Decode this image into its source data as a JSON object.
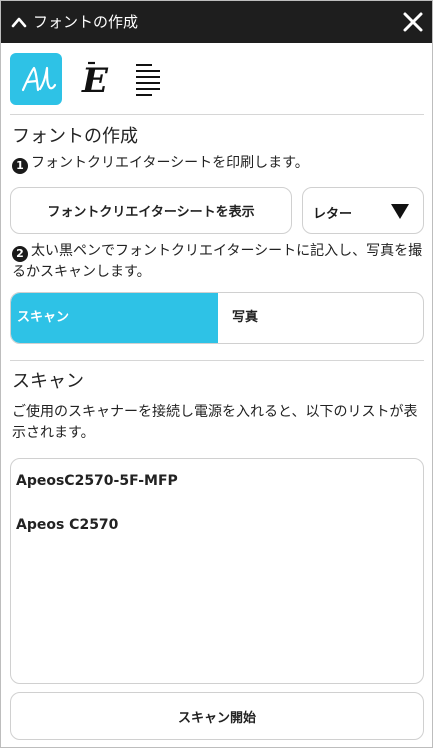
{
  "window": {
    "title": "フォントの作成"
  },
  "toolbar": {
    "tools": [
      {
        "name": "handwriting-font",
        "active": true
      },
      {
        "name": "font-style",
        "active": false
      },
      {
        "name": "text-align",
        "active": false
      }
    ],
    "accent": "#2ec2e6"
  },
  "create": {
    "heading": "フォントの作成",
    "step1_num": "1",
    "step1": "フォントクリエイターシートを印刷します。",
    "show_button": "フォントクリエイターシートを表示",
    "paper_size": "レター",
    "step2_num": "2",
    "step2": "太い黒ペンでフォントクリエイターシートに記入し、写真を撮るかスキャンします。",
    "modes": [
      "スキャン",
      "写真"
    ],
    "selected_mode": "スキャン"
  },
  "scan": {
    "heading": "スキャン",
    "description": "ご使用のスキャナーを接続し電源を入れると、以下のリストが表示されます。",
    "scanners": [
      "ApeosC2570-5F-MFP",
      "Apeos C2570"
    ],
    "start_button": "スキャン開始"
  }
}
